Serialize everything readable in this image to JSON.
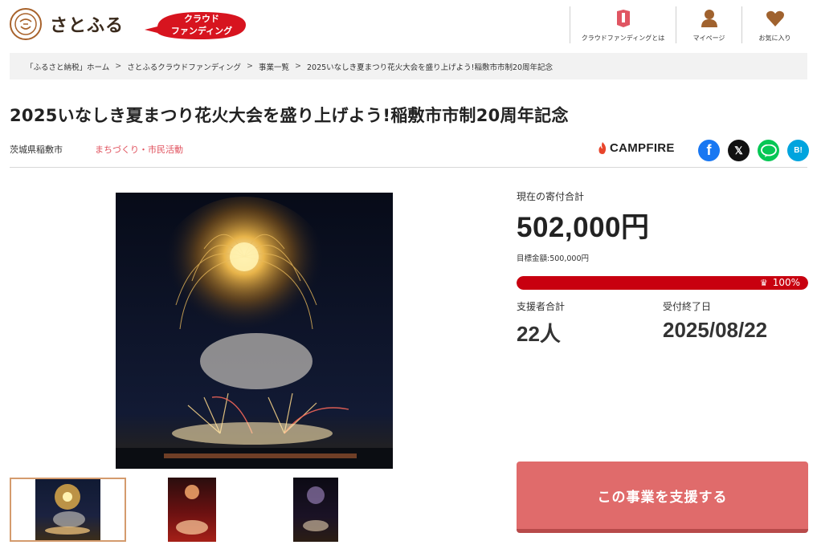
{
  "header": {
    "logo_mark": "ふるさと",
    "logo_text": "さとふる",
    "badge_line1": "クラウド",
    "badge_line2": "ファンディング",
    "nav": [
      {
        "label": "クラウドファンディングとは",
        "icon": "flag-icon"
      },
      {
        "label": "マイページ",
        "icon": "user-icon"
      },
      {
        "label": "お気に入り",
        "icon": "heart-icon"
      }
    ]
  },
  "breadcrumb": [
    "「ふるさと納税」ホーム",
    "さとふるクラウドファンディング",
    "事業一覧",
    "2025いなしき夏まつり花火大会を盛り上げよう!稲敷市市制20周年記念"
  ],
  "breadcrumb_sep": ">",
  "project": {
    "title": "2025いなしき夏まつり花火大会を盛り上げよう!稲敷市市制20周年記念",
    "region": "茨城県稲敷市",
    "category": "まちづくり・市民活動",
    "platform": "CAMPFIRE"
  },
  "share": {
    "facebook": "f",
    "x": "𝕏",
    "line": "LINE",
    "hatena": "B!"
  },
  "stats": {
    "current_label": "現在の寄付合計",
    "current_total": "502,000円",
    "goal_text": "目標金額:500,000円",
    "progress_percent": 100,
    "progress_text": "100%",
    "supporters_label": "支援者合計",
    "supporters_value": "22人",
    "deadline_label": "受付終了日",
    "deadline_value": "2025/08/22"
  },
  "cta": {
    "label": "この事業を支援する"
  },
  "colors": {
    "accent_red": "#c8000f",
    "button": "#e06b6b",
    "category": "#e0505c"
  }
}
